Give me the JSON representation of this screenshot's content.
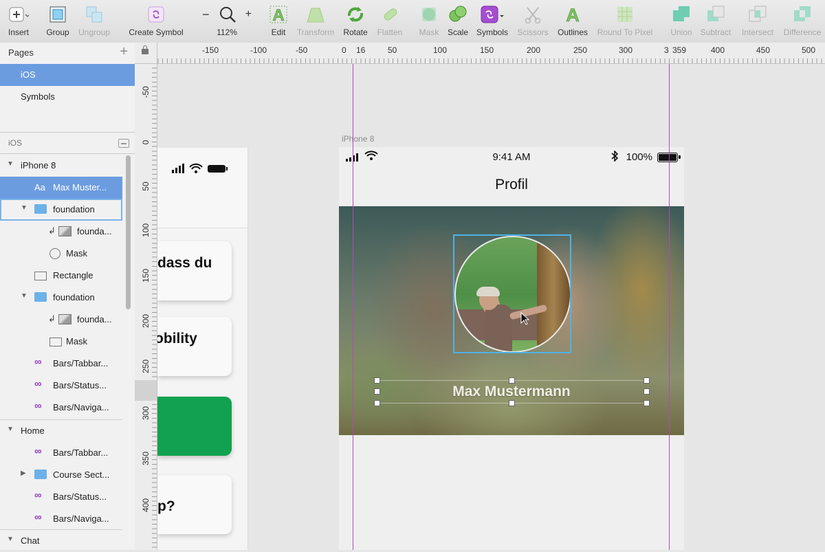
{
  "toolbar": {
    "insert": "Insert",
    "group": "Group",
    "ungroup": "Ungroup",
    "create_symbol": "Create Symbol",
    "zoom": "112%",
    "zoom_minus": "−",
    "zoom_plus": "+",
    "edit": "Edit",
    "transform": "Transform",
    "rotate": "Rotate",
    "flatten": "Flatten",
    "mask": "Mask",
    "scale": "Scale",
    "symbols": "Symbols",
    "scissors": "Scissors",
    "outlines": "Outlines",
    "round_to_pixel": "Round To Pixel",
    "union": "Union",
    "subtract": "Subtract",
    "intersect": "Intersect",
    "difference": "Difference"
  },
  "pages": {
    "title": "Pages",
    "items": [
      "iOS",
      "Symbols"
    ]
  },
  "layers": {
    "header": "iOS",
    "rows": [
      {
        "label": "iPhone 8"
      },
      {
        "label": "Max Muster..."
      },
      {
        "label": "foundation"
      },
      {
        "label": "founda..."
      },
      {
        "label": "Mask"
      },
      {
        "label": "Rectangle"
      },
      {
        "label": "foundation"
      },
      {
        "label": "founda..."
      },
      {
        "label": "Mask"
      },
      {
        "label": "Bars/Tabbar..."
      },
      {
        "label": "Bars/Status..."
      },
      {
        "label": "Bars/Naviga..."
      },
      {
        "label": "Home"
      },
      {
        "label": "Bars/Tabbar..."
      },
      {
        "label": "Course Sect..."
      },
      {
        "label": "Bars/Status..."
      },
      {
        "label": "Bars/Naviga..."
      },
      {
        "label": "Chat"
      }
    ]
  },
  "ruler": {
    "h": [
      "-150",
      "-100",
      "-50",
      "0",
      "16",
      "50",
      "100",
      "150",
      "200",
      "250",
      "300",
      "3",
      "359",
      "400",
      "450",
      "500"
    ],
    "v": [
      "-50",
      "0",
      "50",
      "100",
      "150",
      "200",
      "250",
      "300",
      "350",
      "400"
    ]
  },
  "left_artboard": {
    "cards": [
      "dass du",
      "obility",
      "p?"
    ]
  },
  "artboard": {
    "label": "iPhone 8",
    "status_time": "9:41 AM",
    "status_battery": "100%",
    "nav_title": "Profil",
    "name": "Max Mustermann"
  },
  "colors": {
    "selection": "#6c9ce0",
    "guide": "#b04ab8",
    "selection_box": "#4fb2e6",
    "green_card": "#12a150"
  }
}
